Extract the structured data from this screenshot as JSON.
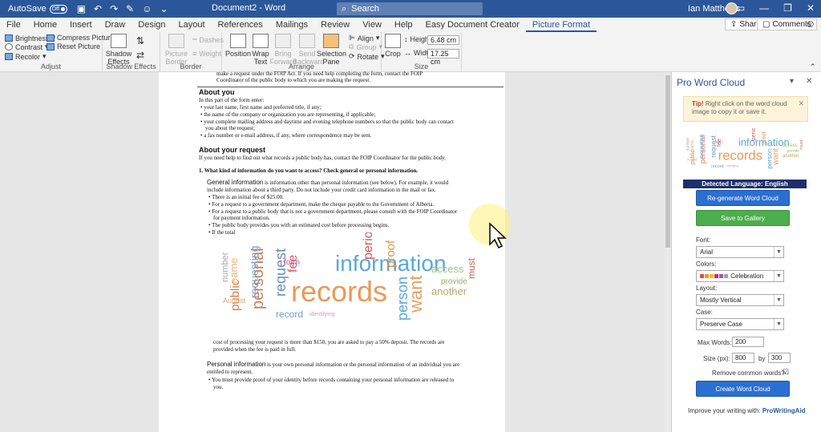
{
  "titlebar": {
    "autosave_label": "AutoSave",
    "autosave_state": "Off",
    "doc_title": "Document2  -  Word",
    "search_placeholder": "Search",
    "user_name": "Ian Matthews"
  },
  "tabs": [
    "File",
    "Home",
    "Insert",
    "Draw",
    "Design",
    "Layout",
    "References",
    "Mailings",
    "Review",
    "View",
    "Help",
    "Easy Document Creator",
    "Picture Format"
  ],
  "active_tab": "Picture Format",
  "share_label": "Share",
  "comments_label": "Comments",
  "ribbon": {
    "adjust": {
      "label": "Adjust",
      "brightness": "Brightness",
      "contrast": "Contrast",
      "recolor": "Recolor",
      "compress": "Compress Pictures",
      "reset": "Reset Picture"
    },
    "shadow": {
      "label": "Shadow Effects",
      "shadow_effects": "Shadow Effects"
    },
    "border": {
      "label": "Border",
      "picture_border": "Picture Border",
      "dashes": "Dashes",
      "weight": "Weight"
    },
    "arrange": {
      "label": "Arrange",
      "position": "Position",
      "wrap_text": "Wrap Text",
      "bring_forward": "Bring Forward",
      "send_backward": "Send Backward",
      "selection_pane": "Selection Pane",
      "align": "Align",
      "group": "Group",
      "rotate": "Rotate"
    },
    "size": {
      "label": "Size",
      "crop": "Crop",
      "height_label": "Height:",
      "height_value": "6.48 cm",
      "width_label": "Width:",
      "width_value": "17.25 cm"
    }
  },
  "document": {
    "prev_line1": "make a request under the FOIP Act. If you need help completing the form, contact the FOIP",
    "prev_line2": "Coordinator of the public body to which you are making the request.",
    "about_you_heading": "About you",
    "about_you_intro": "In this part of the form enter:",
    "bullets_you": [
      "your last name, first name and preferred title, if any;",
      "the name of the company or organization you are representing, if applicable;",
      "your complete mailing address and daytime and evening telephone numbers so that the public body can contact",
      "you about the request;",
      "a fax number or e-mail address, if any, where correspondence may be sent."
    ],
    "about_request_heading": "About your request",
    "about_request_intro": "If you need help to find out what records a public body has, contact the FOIP Coordinator for the public body.",
    "q1": "1.     What kind of information do you want to access? Check general or personal information.",
    "general_heading": "General information",
    "general_line1": " is information other than personal information (see below). For example, it would",
    "general_line2": "include information about a third party.  Do not include your credit card information in the mail or fax.",
    "bullets_general": [
      "There is an initial fee of $25.00.",
      "For a request to a government department, make the cheque payable to the Government of Alberta.",
      "For a request to a public body that is not a government department, please consult with the FOIP Coordinator",
      "for payment information.",
      "The public body provides you with an estimated cost before processing begins.",
      "If the total"
    ],
    "after_cloud_line1": "cost of processing your request is more than $150, you are asked to pay a 50% deposit.  The records are",
    "after_cloud_line2": "provided when the fee is paid in full.",
    "personal_heading": "Personal information",
    "personal_line1": " is your own personal information or the personal information of an individual you are",
    "personal_line2": "entitled to represent.",
    "personal_bullet1": "You must provide proof of your identity before records containing your personal information are released to",
    "personal_bullet2": "you."
  },
  "wordcloud_words": [
    {
      "t": "information",
      "c": "#5aa9d6"
    },
    {
      "t": "records",
      "c": "#e89a5a"
    },
    {
      "t": "personal",
      "c": "#c97d5d"
    },
    {
      "t": "request",
      "c": "#6a8fb8"
    },
    {
      "t": "public",
      "c": "#d47f4f"
    },
    {
      "t": "requesting",
      "c": "#7aa3c9"
    },
    {
      "t": "want",
      "c": "#e0a263"
    },
    {
      "t": "person",
      "c": "#5aa9d6"
    },
    {
      "t": "access",
      "c": "#9ec97a"
    },
    {
      "t": "another",
      "c": "#b5a86a"
    },
    {
      "t": "number",
      "c": "#a7a7a7"
    },
    {
      "t": "name",
      "c": "#e8b47a"
    },
    {
      "t": "August",
      "c": "#d8a67a"
    },
    {
      "t": "period",
      "c": "#c45a5a"
    },
    {
      "t": "proof",
      "c": "#d79a4a"
    },
    {
      "t": "fee",
      "c": "#d65a6a"
    },
    {
      "t": "form",
      "c": "#b55a8a"
    },
    {
      "t": "record",
      "c": "#6a9fd0"
    },
    {
      "t": "provide",
      "c": "#8ab85a"
    },
    {
      "t": "must",
      "c": "#c46a5a"
    },
    {
      "t": "identifying",
      "c": "#c9a0c0"
    }
  ],
  "panel": {
    "title": "Pro Word Cloud",
    "tip_bold": "Tip!",
    "tip_text": " Right click on the word cloud image to copy it or save it.",
    "detected_language": "Detected Language: English",
    "regenerate_label": "Re-generate Word Cloud",
    "save_label": "Save to Gallery",
    "font_label": "Font:",
    "font_value": "Arial",
    "colors_label": "Colors:",
    "colors_value": "Celebration",
    "colors_swatches": [
      "#e74c3c",
      "#f39c12",
      "#f1c40f",
      "#e91e63",
      "#9b59b6",
      "#95a5a6"
    ],
    "layout_label": "Layout:",
    "layout_value": "Mostly Vertical",
    "case_label": "Case:",
    "case_value": "Preserve Case",
    "max_words_label": "Max Words:",
    "max_words_value": "200",
    "size_label": "Size (px):",
    "size_w": "800",
    "size_by": "by",
    "size_h": "300",
    "remove_common_label": "Remove common words?",
    "create_label": "Create Word Cloud",
    "footer_prefix": "Improve your writing with: ",
    "footer_link": "ProWritingAid"
  }
}
